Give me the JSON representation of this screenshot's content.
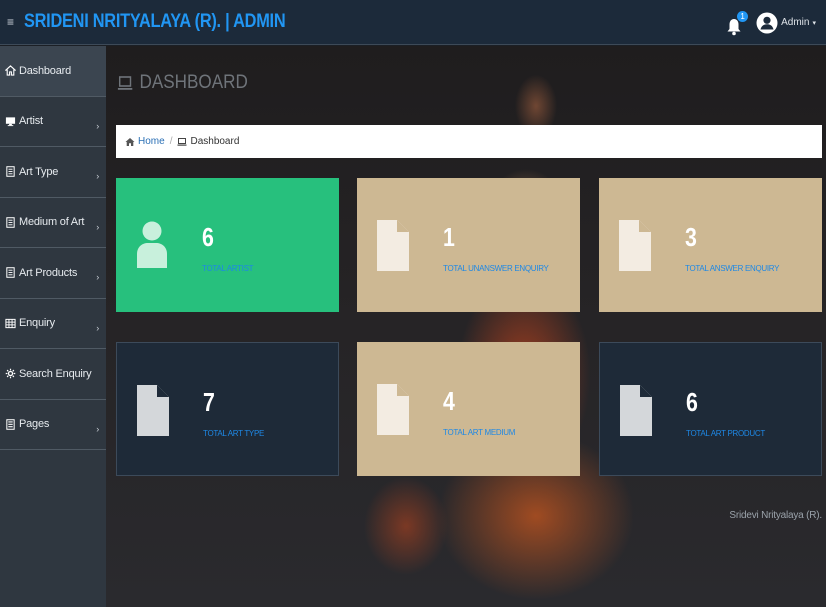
{
  "header": {
    "brand": "SRIDENI NRITYALAYA (R). | ADMIN",
    "hamburger": "≡",
    "notification_count": "1",
    "user_label": "Admin",
    "caret": "▾"
  },
  "sidebar": {
    "items": [
      {
        "label": "Dashboard",
        "icon": "home-icon",
        "has_chevron": false
      },
      {
        "label": "Artist",
        "icon": "monitor-icon",
        "has_chevron": true
      },
      {
        "label": "Art Type",
        "icon": "document-icon",
        "has_chevron": true
      },
      {
        "label": "Medium of Art",
        "icon": "document-icon",
        "has_chevron": true
      },
      {
        "label": "Art Products",
        "icon": "document-icon",
        "has_chevron": true
      },
      {
        "label": "Enquiry",
        "icon": "table-icon",
        "has_chevron": true
      },
      {
        "label": "Search Enquiry",
        "icon": "search-gear-icon",
        "has_chevron": false
      },
      {
        "label": "Pages",
        "icon": "pages-icon",
        "has_chevron": true
      }
    ],
    "chevron": "›"
  },
  "main": {
    "title": "DASHBOARD",
    "breadcrumb": {
      "home": "Home",
      "sep": "/",
      "current": "Dashboard"
    },
    "cards": [
      {
        "value": "6",
        "label": "TOTAL ARTIST",
        "style": "green",
        "icon": "user-icon"
      },
      {
        "value": "1",
        "label": "TOTAL UNANSWER ENQUIRY",
        "style": "tan",
        "icon": "file-icon"
      },
      {
        "value": "3",
        "label": "TOTAL ANSWER ENQUIRY",
        "style": "tan",
        "icon": "file-icon"
      },
      {
        "value": "7",
        "label": "TOTAL ART TYPE",
        "style": "dark",
        "icon": "file-icon"
      },
      {
        "value": "4",
        "label": "TOTAL ART MEDIUM",
        "style": "tan",
        "icon": "file-icon"
      },
      {
        "value": "6",
        "label": "TOTAL ART PRODUCT",
        "style": "dark",
        "icon": "file-icon"
      }
    ],
    "footer": "Sridevi Nrityalaya (R)."
  },
  "colors": {
    "topbar": "#1c2a3a",
    "brand": "#2196f3",
    "sidebar": "#2f3740",
    "green_card": "#27c07d",
    "tan_card": "#cdb893",
    "dark_card": "#1e2a38",
    "label_blue": "#1e88e5"
  }
}
